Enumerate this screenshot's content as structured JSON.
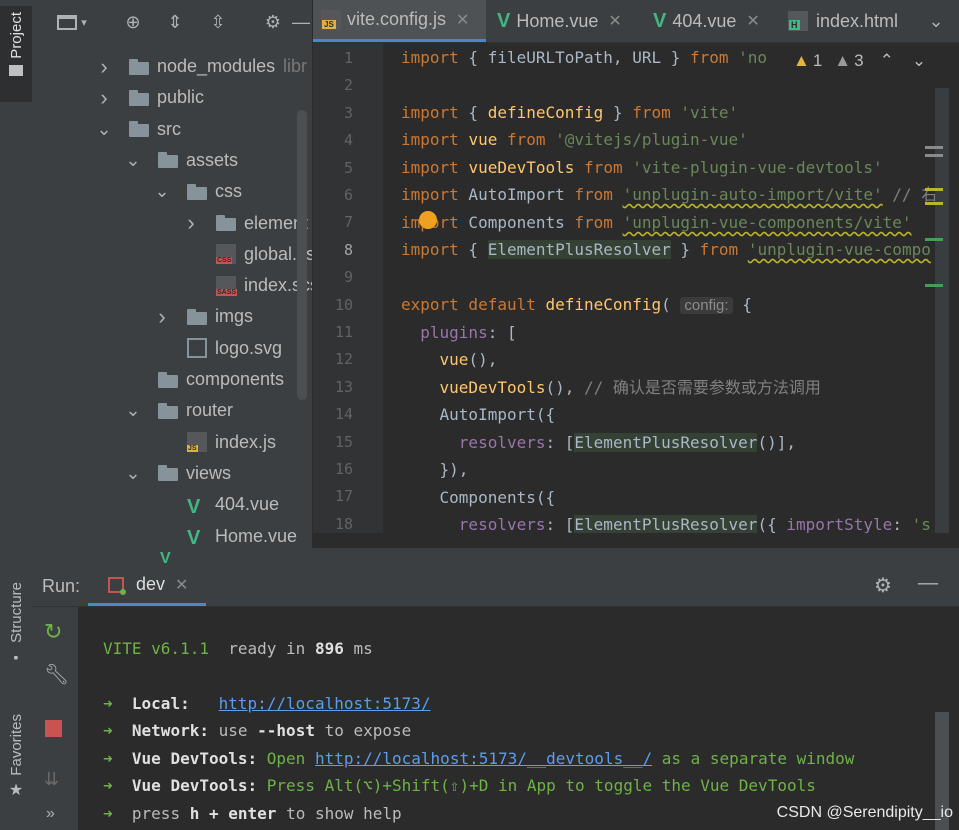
{
  "left_strip": {
    "project_label": "Project",
    "structure_label": "Structure",
    "favorites_label": "Favorites"
  },
  "project_tree": {
    "rows": [
      {
        "label": "node_modules",
        "suffix": "libr",
        "type": "folder",
        "depth": 0,
        "expanded": false
      },
      {
        "label": "public",
        "type": "folder",
        "depth": 0,
        "expanded": false
      },
      {
        "label": "src",
        "type": "folder",
        "depth": 0,
        "expanded": true
      },
      {
        "label": "assets",
        "type": "folder",
        "depth": 1,
        "expanded": true
      },
      {
        "label": "css",
        "type": "folder",
        "depth": 2,
        "expanded": true
      },
      {
        "label": "element",
        "type": "folder",
        "depth": 3,
        "expanded": false
      },
      {
        "label": "global.cs",
        "type": "css",
        "depth": 3
      },
      {
        "label": "index.scs",
        "type": "sass",
        "depth": 3
      },
      {
        "label": "imgs",
        "type": "folder",
        "depth": 2,
        "expanded": false
      },
      {
        "label": "logo.svg",
        "type": "svg",
        "depth": 2
      },
      {
        "label": "components",
        "type": "folder",
        "depth": 1
      },
      {
        "label": "router",
        "type": "folder",
        "depth": 1,
        "expanded": true
      },
      {
        "label": "index.js",
        "type": "js",
        "depth": 2
      },
      {
        "label": "views",
        "type": "folder",
        "depth": 1,
        "expanded": true
      },
      {
        "label": "404.vue",
        "type": "vue",
        "depth": 2
      },
      {
        "label": "Home.vue",
        "type": "vue",
        "depth": 2
      }
    ],
    "badges": {
      "css": "CSS",
      "sass": "SASS",
      "js": "JS"
    }
  },
  "editor": {
    "tabs": [
      {
        "label": "vite.config.js",
        "icon": "js-file-icon",
        "active": true
      },
      {
        "label": "Home.vue",
        "icon": "vue-icon"
      },
      {
        "label": "404.vue",
        "icon": "vue-icon"
      },
      {
        "label": "index.html",
        "icon": "html-file-icon"
      }
    ],
    "inspections": {
      "warnings": "1",
      "weak_warnings": "3"
    },
    "line_numbers": [
      "1",
      "2",
      "3",
      "4",
      "5",
      "6",
      "7",
      "8",
      "9",
      "10",
      "11",
      "12",
      "13",
      "14",
      "15",
      "16",
      "17",
      "18"
    ],
    "code_hint": "config:"
  },
  "run_panel": {
    "run_label": "Run:",
    "config_name": "dev",
    "console": {
      "vite": "VITE v6.1.1",
      "ready": "ready in",
      "ready_ms": "896",
      "ms": "ms",
      "local_label": "Local:",
      "local_url": "http://localhost:5173/",
      "network_label": "Network:",
      "network_use": "use",
      "network_host": "--host",
      "network_expose": "to expose",
      "devtools_label": "Vue DevTools:",
      "devtools_open": "Open",
      "devtools_url": "http://localhost:5173/__devtools__/",
      "devtools_sep": "as a separate window",
      "devtools_press": "Press Alt(⌥)+Shift(⇧)+D in App to toggle the Vue DevTools",
      "press": "press",
      "help_key": "h + enter",
      "help_rest": "to show help"
    }
  },
  "watermark": "CSDN @Serendipity__io",
  "colors": {
    "keyword": "#cc7832",
    "string": "#6a8759",
    "function": "#ffc66d",
    "vue_green": "#41b883",
    "run_green": "#6eb346"
  }
}
